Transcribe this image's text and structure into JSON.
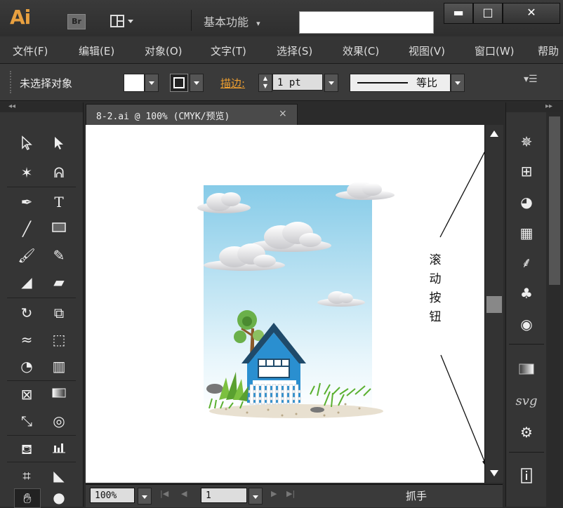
{
  "app": {
    "logo": "Ai",
    "bridge_label": "Br",
    "workspace": "基本功能"
  },
  "window_buttons": {
    "minimize": "▬",
    "restore": "□",
    "close": "✕"
  },
  "menu": [
    "文件(F)",
    "编辑(E)",
    "对象(O)",
    "文字(T)",
    "选择(S)",
    "效果(C)",
    "视图(V)",
    "窗口(W)",
    "帮助"
  ],
  "control": {
    "selection_status": "未选择对象",
    "stroke_label": "描边:",
    "stroke_weight": "1 pt",
    "profile": "等比"
  },
  "document": {
    "tab_label": "8-2.ai @ 100% (CMYK/预览)",
    "close": "×"
  },
  "annotation": {
    "text": "滚动按钮"
  },
  "status": {
    "zoom": "100%",
    "page": "1",
    "tool_name": "抓手"
  },
  "colors": {
    "accent": "#e8a040",
    "stroke_label": "#f0a030",
    "sky_top": "#86cbe8",
    "house": "#2a8fd0"
  },
  "icons": {
    "tools": [
      "selection-arrow-icon",
      "direct-selection-icon",
      "magic-wand-icon",
      "lasso-icon",
      "pen-icon",
      "type-icon",
      "line-segment-icon",
      "rectangle-icon",
      "paintbrush-icon",
      "pencil-icon",
      "blob-brush-icon",
      "eraser-icon",
      "rotate-icon",
      "scale-icon",
      "warp-icon",
      "free-transform-icon",
      "shape-builder-icon",
      "perspective-grid-icon",
      "mesh-icon",
      "gradient-icon",
      "eyedropper-icon",
      "blend-icon",
      "symbol-sprayer-icon",
      "column-graph-icon",
      "artboard-icon",
      "slice-icon",
      "hand-icon",
      "zoom-icon"
    ],
    "right_panel": [
      "color-wheel-icon",
      "align-icon",
      "palette-icon",
      "swatches-icon",
      "brushes-icon",
      "symbols-icon",
      "appearance-icon",
      "gradient-panel-icon",
      "svg-filter-icon",
      "graphic-styles-icon",
      "document-info-icon"
    ]
  }
}
